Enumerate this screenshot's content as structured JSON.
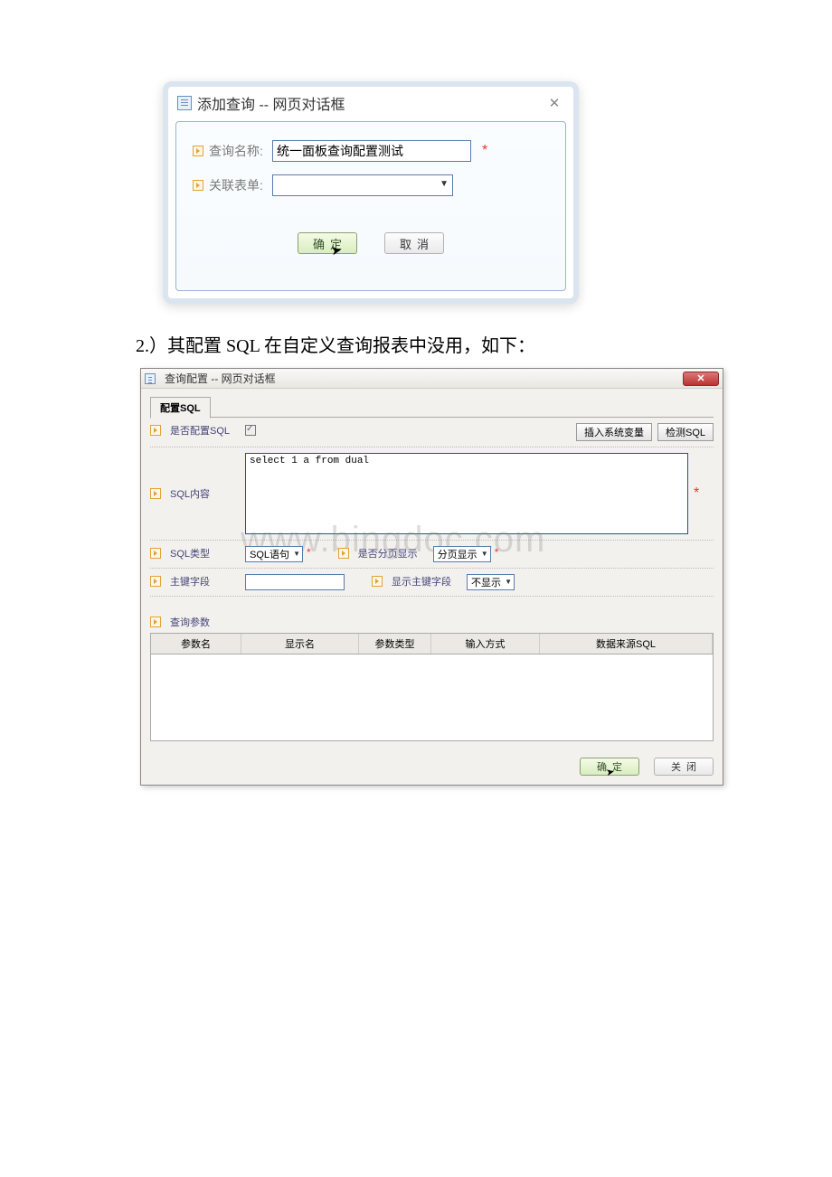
{
  "dialog1": {
    "title": "添加查询 -- 网页对话框",
    "close_glyph": "✕",
    "row1_label": "查询名称:",
    "row1_value": "统一面板查询配置测试",
    "row2_label": "关联表单:",
    "ok_label": "确定",
    "cancel_label": "取消"
  },
  "caption": "2.）其配置 SQL 在自定义查询报表中没用，如下：",
  "dialog2": {
    "title": "查询配置 -- 网页对话框",
    "close_glyph": "✕",
    "tab_label": "配置SQL",
    "row_is_sql": "是否配置SQL",
    "btn_insert_var": "插入系统变量",
    "btn_check_sql": "检测SQL",
    "row_sql_content": "SQL内容",
    "sql_text": "select 1 a from dual",
    "row_sql_type": "SQL类型",
    "sql_type_value": "SQL语句",
    "row_page": "是否分页显示",
    "page_value": "分页显示",
    "row_pk": "主键字段",
    "row_show_pk": "显示主键字段",
    "show_pk_value": "不显示",
    "params_label": "查询参数",
    "th_param": "参数名",
    "th_display": "显示名",
    "th_type": "参数类型",
    "th_input": "输入方式",
    "th_source": "数据来源SQL",
    "ok_label": "确定",
    "close_label": "关闭"
  },
  "watermark": "www.bingdoc.com",
  "star": "*"
}
